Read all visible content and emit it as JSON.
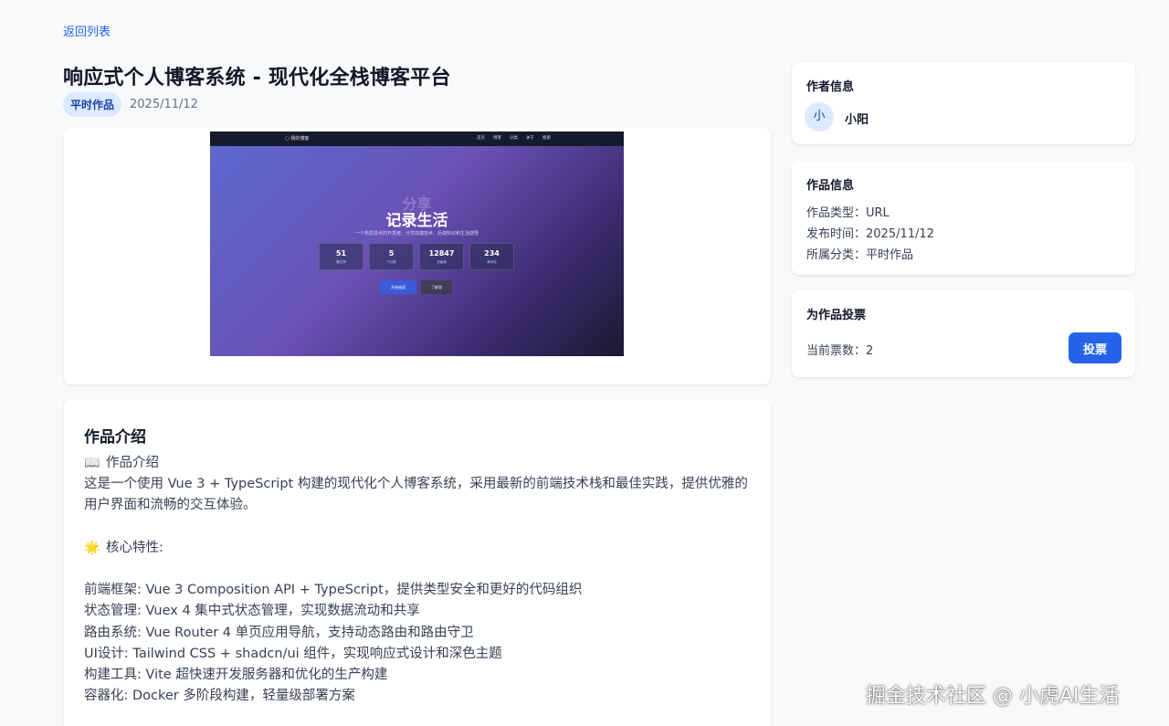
{
  "nav": {
    "back_label": "返回列表"
  },
  "article": {
    "title": "响应式个人博客系统 - 现代化全栈博客平台",
    "category": "平时作品",
    "date": "2025/11/12"
  },
  "preview": {
    "logo": "▢ 我的博客",
    "nav_items": [
      "首页",
      "博客",
      "分类",
      "关于",
      "搜索"
    ],
    "hero_ghost": "分享",
    "hero_title": "记录生活",
    "subtitle": "一个热爱技术的开发者，分享前端技术、后端知识和生活感悟",
    "stats": [
      {
        "value": "51",
        "label": "篇文章"
      },
      {
        "value": "5",
        "label": "个分类"
      },
      {
        "value": "12847",
        "label": "总阅读"
      },
      {
        "value": "234",
        "label": "条评论"
      }
    ],
    "primary_button": "开始阅读",
    "secondary_button": "了解我"
  },
  "intro": {
    "section_title": "作品介绍",
    "heading_icon": "📖",
    "heading": "作品介绍",
    "description": "这是一个使用 Vue 3 + TypeScript 构建的现代化个人博客系统，采用最新的前端技术栈和最佳实践，提供优雅的用户界面和流畅的交互体验。",
    "features_icon": "🌟",
    "features_heading": "核心特性:",
    "features": [
      "前端框架: Vue 3 Composition API + TypeScript，提供类型安全和更好的代码组织",
      "状态管理: Vuex 4 集中式状态管理，实现数据流动和共享",
      "路由系统: Vue Router 4 单页应用导航，支持动态路由和路由守卫",
      "UI设计: Tailwind CSS + shadcn/ui 组件，实现响应式设计和深色主题",
      "构建工具: Vite 超快速开发服务器和优化的生产构建",
      "容器化: Docker 多阶段构建，轻量级部署方案"
    ]
  },
  "author": {
    "section_title": "作者信息",
    "avatar_text": "小",
    "name": "小阳"
  },
  "work_info": {
    "section_title": "作品信息",
    "type": "作品类型：URL",
    "published": "发布时间：2025/11/12",
    "category": "所属分类：平时作品"
  },
  "vote": {
    "section_title": "为作品投票",
    "count_text": "当前票数：2",
    "button_label": "投票"
  },
  "watermark": "掘金技术社区 @ 小虎AI生活"
}
